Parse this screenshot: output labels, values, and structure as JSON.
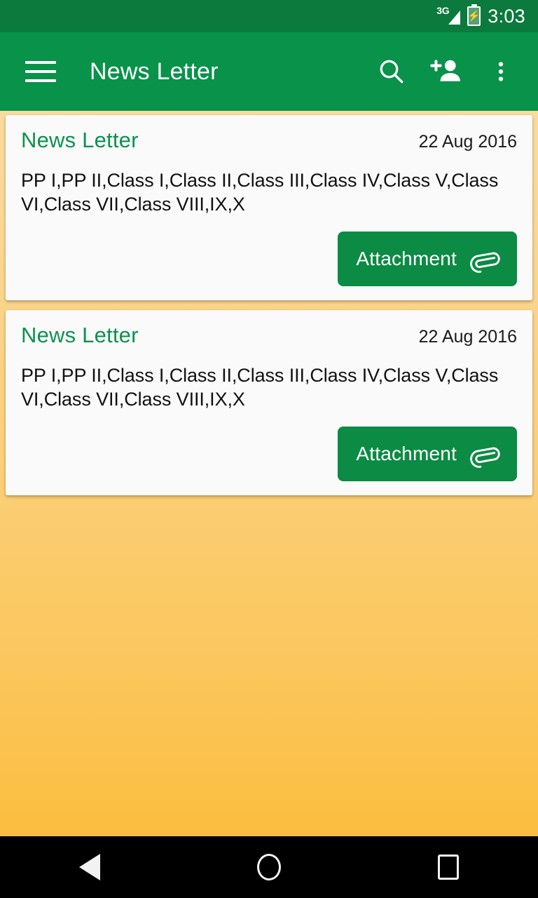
{
  "status_bar": {
    "network_label": "3G",
    "signal_icon": "signal-bars-icon",
    "battery_icon": "battery-charging-icon",
    "time": "3:03",
    "background_color": "#0b7a3c"
  },
  "toolbar": {
    "menu_icon": "hamburger-menu-icon",
    "title": "News Letter",
    "search_icon": "search-icon",
    "add_person_icon": "add-person-icon",
    "overflow_icon": "more-vertical-icon",
    "background_color": "#08924a"
  },
  "theme": {
    "accent_green": "#0b8b43",
    "title_green": "#0e9150",
    "background_top": "#fae0a8",
    "background_bottom": "#fbbb38",
    "card_background": "#fafafa"
  },
  "cards": [
    {
      "title": "News Letter",
      "date": "22 Aug 2016",
      "body": "PP I,PP II,Class I,Class II,Class III,Class IV,Class V,Class VI,Class VII,Class VIII,IX,X",
      "attachment_label": "Attachment",
      "attachment_icon": "paperclip-icon"
    },
    {
      "title": "News Letter",
      "date": "22 Aug 2016",
      "body": "PP I,PP II,Class I,Class II,Class III,Class IV,Class V,Class VI,Class VII,Class VIII,IX,X",
      "attachment_label": "Attachment",
      "attachment_icon": "paperclip-icon"
    }
  ],
  "nav_bar": {
    "back_icon": "back-triangle-icon",
    "home_icon": "home-circle-icon",
    "recents_icon": "recents-square-icon"
  }
}
